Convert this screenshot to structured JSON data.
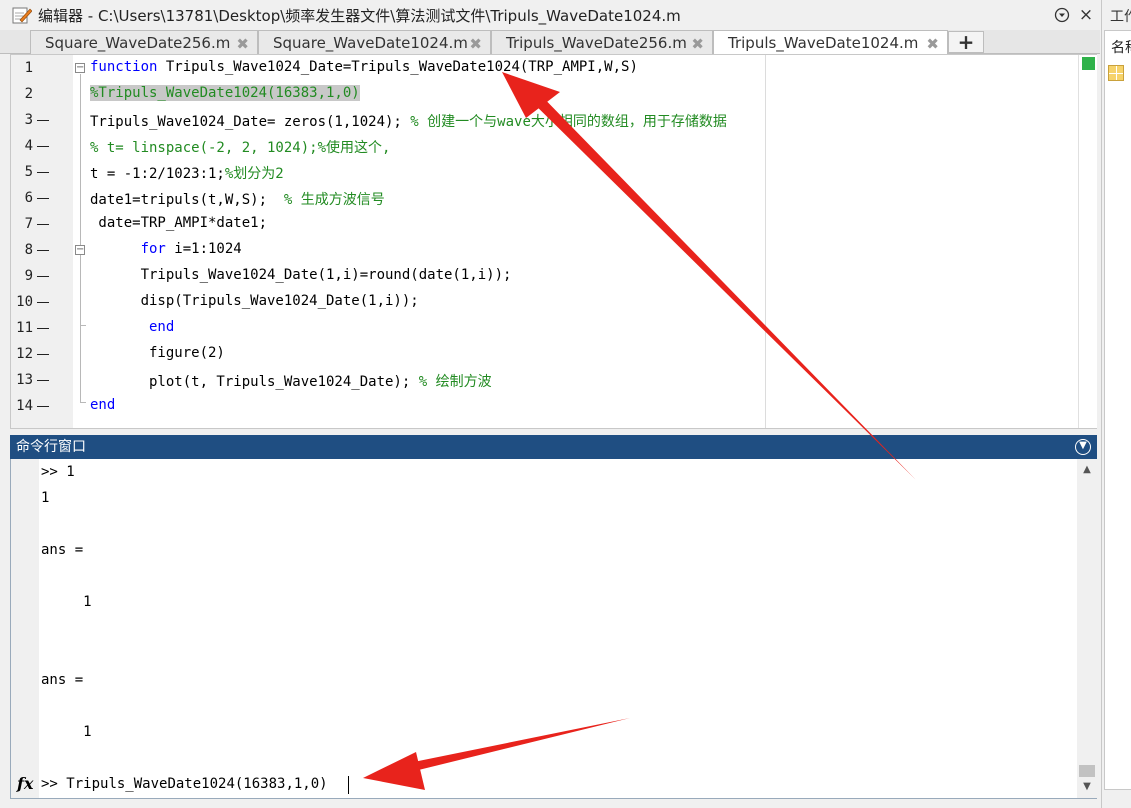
{
  "window": {
    "title": "编辑器 - C:\\Users\\13781\\Desktop\\频率发生器文件\\算法测试文件\\Tripuls_WaveDate1024.m"
  },
  "tabs": [
    {
      "label": "Square_WaveDate256.m",
      "active": false
    },
    {
      "label": "Square_WaveDate1024.m",
      "active": false
    },
    {
      "label": "Tripuls_WaveDate256.m",
      "active": false
    },
    {
      "label": "Tripuls_WaveDate1024.m",
      "active": true
    }
  ],
  "editor": {
    "line_numbers": [
      "1",
      "2",
      "3",
      "4",
      "5",
      "6",
      "7",
      "8",
      "9",
      "10",
      "11",
      "12",
      "13",
      "14"
    ],
    "lines": [
      {
        "kw": "function",
        "code": " Tripuls_Wave1024_Date=Tripuls_WaveDate1024(TRP_AMPI,W,S)",
        "comment": ""
      },
      {
        "sel": "%Tripuls_WaveDate1024(16383,1,0)"
      },
      {
        "code": "Tripuls_Wave1024_Date= zeros(1,1024); ",
        "comment": "% 创建一个与wave大小相同的数组，用于存储数据"
      },
      {
        "code": "",
        "comment": "% t= linspace(-2, 2, 1024);%使用这个,"
      },
      {
        "code": "t = -1:2/1023:1;",
        "comment": "%划分为2"
      },
      {
        "code": "date1=tripuls(t,W,S);  ",
        "comment": "% 生成方波信号"
      },
      {
        "code": " date=TRP_AMPI*date1;",
        "comment": ""
      },
      {
        "kw": "      for",
        "code": " i=1:1024",
        "comment": ""
      },
      {
        "code": "      Tripuls_Wave1024_Date(1,i)=round(date(1,i));",
        "comment": ""
      },
      {
        "code": "      disp(Tripuls_Wave1024_Date(1,i));",
        "comment": ""
      },
      {
        "kw": "       end",
        "code": "",
        "comment": ""
      },
      {
        "code": "       figure(2)",
        "comment": ""
      },
      {
        "code": "       plot(t, Tripuls_Wave1024_Date); ",
        "comment": "% 绘制方波"
      },
      {
        "kw": "end",
        "code": "",
        "comment": ""
      }
    ]
  },
  "command_window": {
    "title": "命令行窗口",
    "output": [
      ">> 1",
      "1",
      "ans =",
      "     1",
      "ans =",
      "     1"
    ],
    "prompt": ">> ",
    "current_input": "Tripuls_WaveDate1024(16383,1,0)"
  },
  "workspace": {
    "title": "工作区",
    "column_header": "名称"
  },
  "colors": {
    "keyword": "#0000ff",
    "comment": "#228b22",
    "command_header": "#1f4e82",
    "annotation_arrow": "#e8231c"
  }
}
